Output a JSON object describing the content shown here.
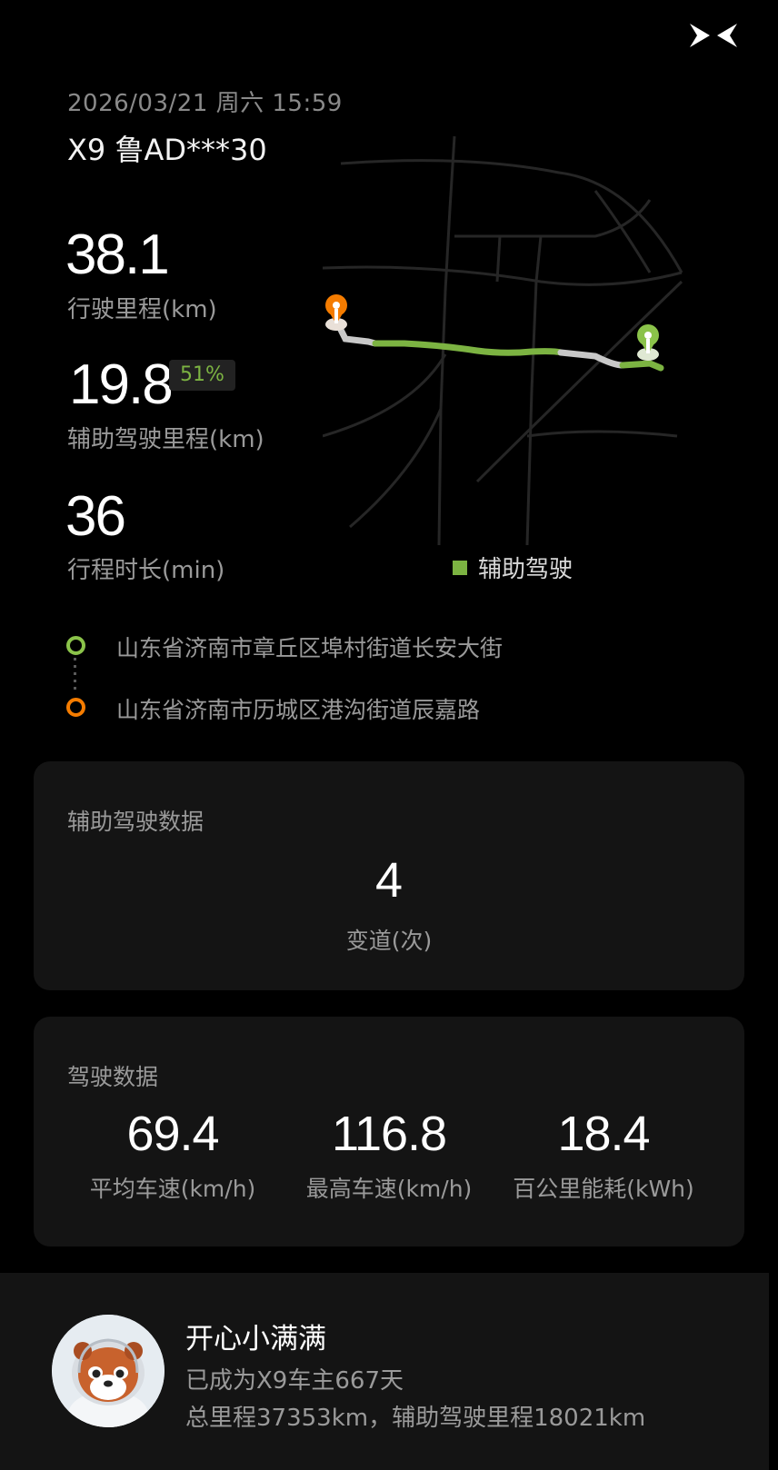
{
  "brand": {
    "logo_icon": "xpeng-logo-icon"
  },
  "trip": {
    "datetime": "2026/03/21 周六 15:59",
    "vehicle": "X9 鲁AD***30",
    "mileage_value": "38.1",
    "mileage_label": "行驶里程(km)",
    "assist_value": "19.8",
    "assist_percent": "51%",
    "assist_label": "辅助驾驶里程(km)",
    "duration_value": "36",
    "duration_label": "行程时长(min)"
  },
  "map": {
    "legend_label": "辅助驾驶",
    "assist_color": "#7cb342",
    "route_color": "#c8c8c8",
    "start_pin_color": "#8bc34a",
    "end_pin_color": "#f57c00"
  },
  "route": {
    "start_address": "山东省济南市章丘区埠村街道长安大街",
    "end_address": "山东省济南市历城区港沟街道辰嘉路"
  },
  "assist_card": {
    "title": "辅助驾驶数据",
    "lane_changes_value": "4",
    "lane_changes_label": "变道(次)"
  },
  "drive_card": {
    "title": "驾驶数据",
    "stats": [
      {
        "value": "69.4",
        "label": "平均车速(km/h)"
      },
      {
        "value": "116.8",
        "label": "最高车速(km/h)"
      },
      {
        "value": "18.4",
        "label": "百公里能耗(kWh)"
      }
    ]
  },
  "profile": {
    "avatar_icon": "red-panda-avatar-icon",
    "name": "开心小满满",
    "owner_days": "已成为X9车主667天",
    "totals": "总里程37353km，辅助驾驶里程18021km"
  }
}
